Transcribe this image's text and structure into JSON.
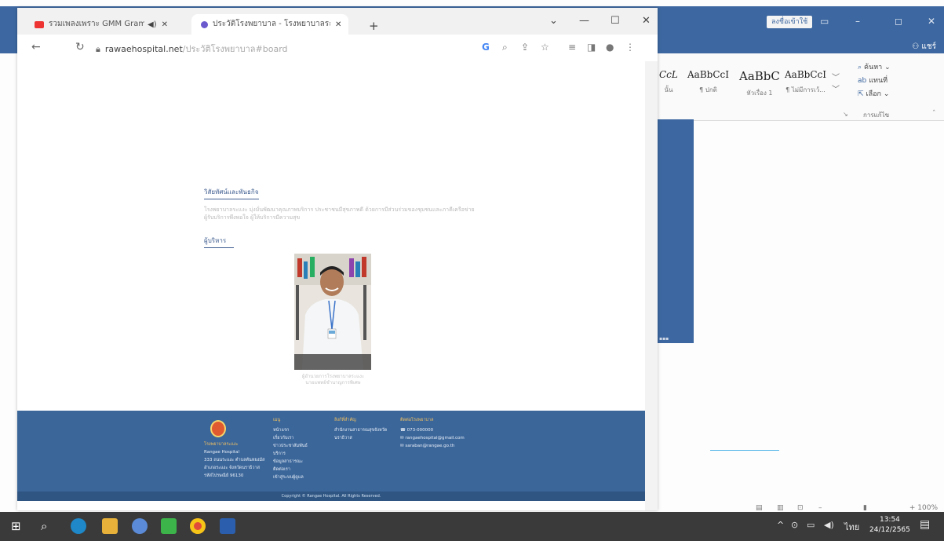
{
  "word": {
    "login_button": "ลงชื่อเข้าใช้",
    "share": "แชร์",
    "styles": [
      {
        "sample": "CcL",
        "name": "นั้น"
      },
      {
        "sample": "AaBbCcI",
        "name": "¶ ปกติ"
      },
      {
        "sample": "AaBbC",
        "name": "หัวเรื่อง 1"
      },
      {
        "sample": "AaBbCcI",
        "name": "¶ ไม่มีการเว้..."
      }
    ],
    "find": "ค้นหา",
    "replace": "แทนที่",
    "select": "เลือก",
    "editing_group": "การแก้ไข",
    "zoom": "100%"
  },
  "browser": {
    "tabs": [
      {
        "label": "รวมเพลงเพราะ GMM Gramm",
        "active": false
      },
      {
        "label": "ประวัติโรงพยาบาล - โรงพยาบาลระแง",
        "active": true
      }
    ],
    "url_host": "rawaehospital.net",
    "url_path": "/ประวัติโรงพยาบาล#board"
  },
  "page": {
    "vision_title": "วิสัยทัศน์และพันธกิจ",
    "vision_text_1": "โรงพยาบาลระแงะ มุ่งมั่นพัฒนาคุณภาพบริการ ประชาชนมีสุขภาพดี ด้วยการมีส่วนร่วมของชุมชนและภาคีเครือข่าย",
    "vision_text_2": "ผู้รับบริการพึงพอใจ ผู้ให้บริการมีความสุข",
    "director_title": "ผู้บริหาร",
    "caption_1": "ผู้อำนวยการโรงพยาบาลระแงะ",
    "caption_2": "นายแพทย์ชำนาญการพิเศษ"
  },
  "footer": {
    "org_name": "โรงพยาบาลระแงะ",
    "address_lines": [
      "Rangae Hospital",
      "333 ถนนระแงะ ตำบลตันหยงมัส",
      "อำเภอระแงะ จังหวัดนราธิวาส",
      "รหัสไปรษณีย์ 96130"
    ],
    "menu_head": "เมนู",
    "menu_items": [
      "หน้าแรก",
      "เกี่ยวกับเรา",
      "ข่าวประชาสัมพันธ์",
      "บริการ",
      "ข้อมูลสาธารณะ",
      "ติดต่อเรา",
      "เข้าสู่ระบบผู้ดูแล"
    ],
    "links_head": "ลิงก์ที่สำคัญ",
    "links_text": "สำนักงานสาธารณสุขจังหวัดนราธิวาส",
    "contact_head": "ติดต่อโรงพยาบาล",
    "contact_phone": "073-000000",
    "contact_email_1": "rangaehospital@gmail.com",
    "contact_email_2": "saraban@rangae.go.th",
    "copyright": "Copyright © Rangae Hospital. All Rights Reserved."
  },
  "taskbar": {
    "lang": "ไทย",
    "time": "13:54",
    "date": "24/12/2565"
  },
  "colors": {
    "word_blue": "#3d67a0",
    "footer_blue": "#3b669a",
    "taskbar": "#3a3a3a"
  }
}
